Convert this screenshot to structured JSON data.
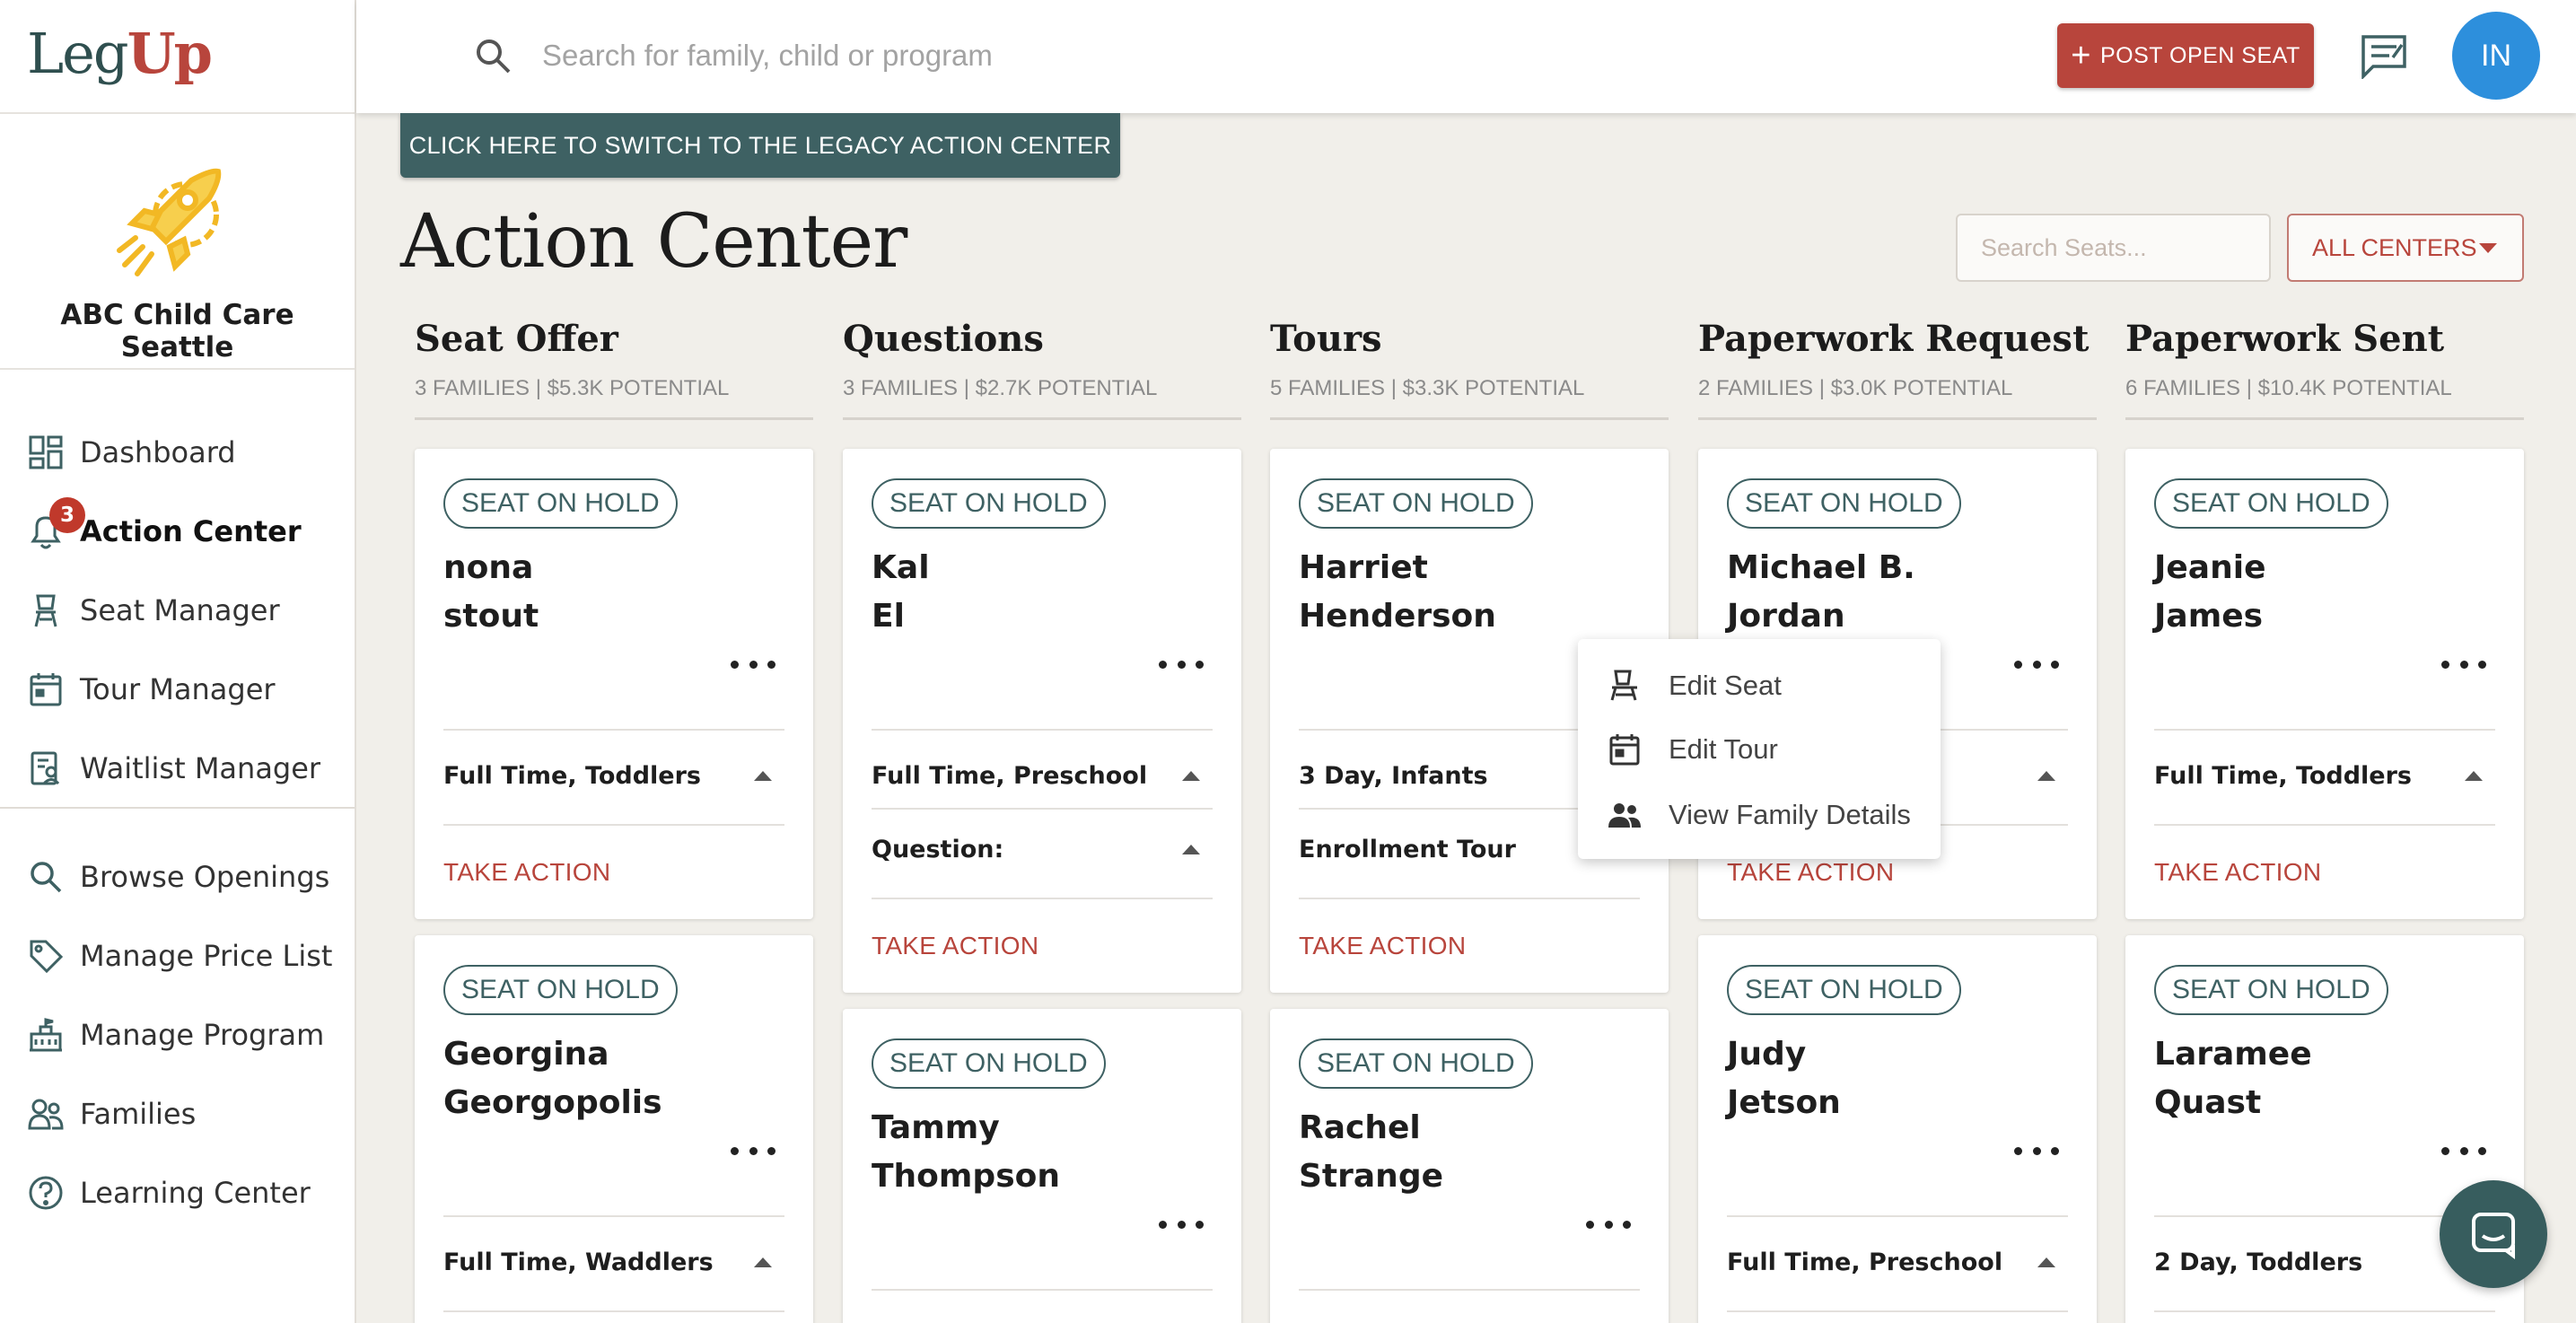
{
  "brand": {
    "logo_left": "Leg",
    "logo_right": "Up"
  },
  "colors": {
    "brand_red": "#b8453c",
    "brand_teal": "#3e6163",
    "avatar_blue": "#2d8fdc",
    "page_bg": "#f1efea"
  },
  "sidebar": {
    "center_name": "ABC Child Care Seattle",
    "items": [
      {
        "label": "Dashboard",
        "icon": "dashboard-icon"
      },
      {
        "label": "Action Center",
        "icon": "bell-icon",
        "badge": "3",
        "active": true
      },
      {
        "label": "Seat Manager",
        "icon": "seat-icon"
      },
      {
        "label": "Tour Manager",
        "icon": "calendar-icon"
      },
      {
        "label": "Waitlist Manager",
        "icon": "waitlist-icon"
      },
      {
        "label": "Browse Openings",
        "icon": "search-icon"
      },
      {
        "label": "Manage Price List",
        "icon": "tag-icon"
      },
      {
        "label": "Manage Program",
        "icon": "school-icon"
      },
      {
        "label": "Families",
        "icon": "people-icon"
      },
      {
        "label": "Learning Center",
        "icon": "help-icon"
      }
    ]
  },
  "topbar": {
    "search_placeholder": "Search for family, child or program",
    "post_seat": "POST OPEN SEAT",
    "avatar": "IN"
  },
  "main": {
    "legacy_button": "CLICK HERE TO SWITCH TO THE LEGACY ACTION CENTER",
    "title": "Action Center",
    "search_seats_placeholder": "Search Seats...",
    "centers_filter": "ALL CENTERS",
    "take_action": "TAKE ACTION",
    "columns": [
      {
        "title": "Seat Offer",
        "subtitle": "3 FAMILIES | $5.3K POTENTIAL",
        "cards": [
          {
            "status": "SEAT ON HOLD",
            "first": "nona",
            "last": "stout",
            "program": "Full Time, Toddlers"
          },
          {
            "status": "SEAT ON HOLD",
            "first": "Georgina",
            "last": "Georgopolis",
            "program": "Full Time, Waddlers"
          }
        ]
      },
      {
        "title": "Questions",
        "subtitle": "3 FAMILIES | $2.7K POTENTIAL",
        "cards": [
          {
            "status": "SEAT ON HOLD",
            "first": "Kal",
            "last": "El",
            "program": "Full Time, Preschool",
            "extra": "Question:"
          },
          {
            "status": "SEAT ON HOLD",
            "first": "Tammy",
            "last": "Thompson"
          }
        ]
      },
      {
        "title": "Tours",
        "subtitle": "5 FAMILIES | $3.3K POTENTIAL",
        "cards": [
          {
            "status": "SEAT ON HOLD",
            "first": "Harriet",
            "last": "Henderson",
            "program": "3 Day, Infants",
            "extra": "Enrollment Tour"
          },
          {
            "status": "SEAT ON HOLD",
            "first": "Rachel",
            "last": "Strange"
          }
        ]
      },
      {
        "title": "Paperwork Request",
        "subtitle": "2 FAMILIES | $3.0K POTENTIAL",
        "cards": [
          {
            "status": "SEAT ON HOLD",
            "first": "Michael B.",
            "last": "Jordan"
          },
          {
            "status": "SEAT ON HOLD",
            "first": "Judy",
            "last": "Jetson",
            "program": "Full Time, Preschool"
          }
        ]
      },
      {
        "title": "Paperwork Sent",
        "subtitle": "6 FAMILIES | $10.4K POTENTIAL",
        "cards": [
          {
            "status": "SEAT ON HOLD",
            "first": "Jeanie",
            "last": "James",
            "program": "Full Time, Toddlers"
          },
          {
            "status": "SEAT ON HOLD",
            "first": "Laramee",
            "last": "Quast",
            "program": "2 Day, Toddlers"
          }
        ]
      }
    ]
  },
  "context_menu": {
    "items": [
      {
        "label": "Edit Seat",
        "icon": "seat-icon"
      },
      {
        "label": "Edit Tour",
        "icon": "calendar-icon"
      },
      {
        "label": "View Family Details",
        "icon": "people-icon"
      }
    ]
  }
}
